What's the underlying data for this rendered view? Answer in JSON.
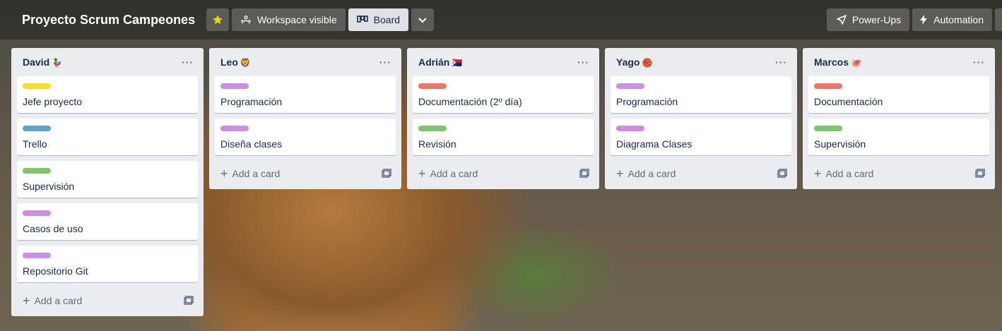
{
  "header": {
    "board_title": "Proyecto Scrum Campeones",
    "visibility_label": "Workspace visible",
    "view_label": "Board",
    "powerups_label": "Power-Ups",
    "automation_label": "Automation"
  },
  "colors": {
    "yellow": "#f5dd29",
    "blue": "#5ba4cf",
    "green": "#7bc86c",
    "purple": "#cd8de5",
    "red": "#ef7564",
    "star": "#f2d600"
  },
  "lists": [
    {
      "title": "David",
      "emoji": "🦆",
      "cards": [
        {
          "label_color": "#f5dd29",
          "text": "Jefe proyecto"
        },
        {
          "label_color": "#5ba4cf",
          "text": "Trello"
        },
        {
          "label_color": "#7bc86c",
          "text": "Supervisión"
        },
        {
          "label_color": "#cd8de5",
          "text": "Casos de uso"
        },
        {
          "label_color": "#cd8de5",
          "text": "Repositorio Git"
        }
      ],
      "add_label": "Add a card"
    },
    {
      "title": "Leo",
      "emoji": "🦁",
      "cards": [
        {
          "label_color": "#cd8de5",
          "text": "Programación"
        },
        {
          "label_color": "#cd8de5",
          "text": "Diseña clases"
        }
      ],
      "add_label": "Add a card"
    },
    {
      "title": "Adrián",
      "emoji": "🇸🇽",
      "cards": [
        {
          "label_color": "#ef7564",
          "text": "Documentación (2º día)"
        },
        {
          "label_color": "#7bc86c",
          "text": "Revisión"
        }
      ],
      "add_label": "Add a card"
    },
    {
      "title": "Yago",
      "emoji": "🏀",
      "cards": [
        {
          "label_color": "#cd8de5",
          "text": "Programación"
        },
        {
          "label_color": "#cd8de5",
          "text": "Diagrama Clases"
        }
      ],
      "add_label": "Add a card"
    },
    {
      "title": "Marcos",
      "emoji": "🐙",
      "cards": [
        {
          "label_color": "#ef7564",
          "text": "Documentación"
        },
        {
          "label_color": "#7bc86c",
          "text": "Supervisión"
        }
      ],
      "add_label": "Add a card"
    }
  ]
}
